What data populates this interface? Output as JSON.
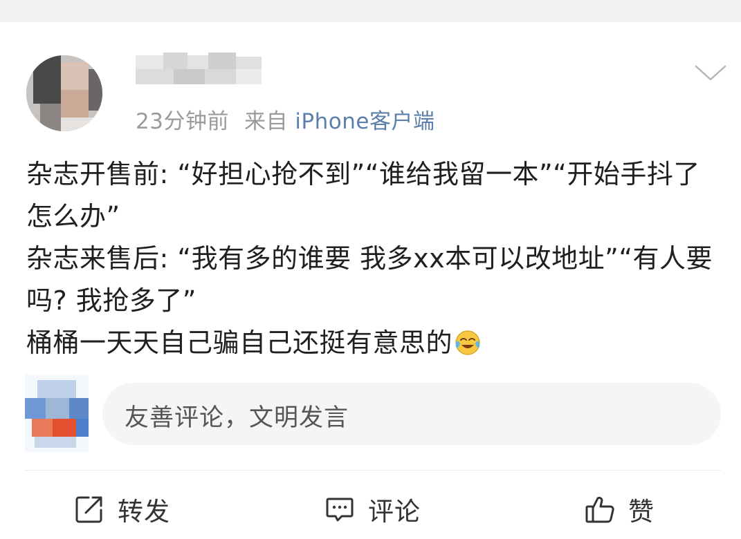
{
  "post": {
    "username": "",
    "time": "23分钟前",
    "source_prefix": "来自",
    "source": "iPhone客户端",
    "lines": [
      "杂志开售前: “好担心抢不到”“谁给我留一本”“开始手抖了怎么办”",
      "杂志来售后: “我有多的谁要 我多xx本可以改地址”“有人要吗? 我抢多了”",
      "桶桶一天天自己骗自己还挺有意思的"
    ],
    "emoji": "laugh-cry-emoji"
  },
  "comment": {
    "placeholder": "友善评论，文明发言"
  },
  "actions": {
    "repost": "转发",
    "comment": "评论",
    "like": "赞"
  },
  "icons": {
    "more": "chevron-down-icon",
    "repost": "share-icon",
    "comment": "comment-icon",
    "like": "thumbs-up-icon"
  },
  "colors": {
    "source_link": "#5b7faa",
    "meta": "#9a9a9a",
    "text": "#1f1f1f",
    "input_bg": "#f5f5f5"
  }
}
